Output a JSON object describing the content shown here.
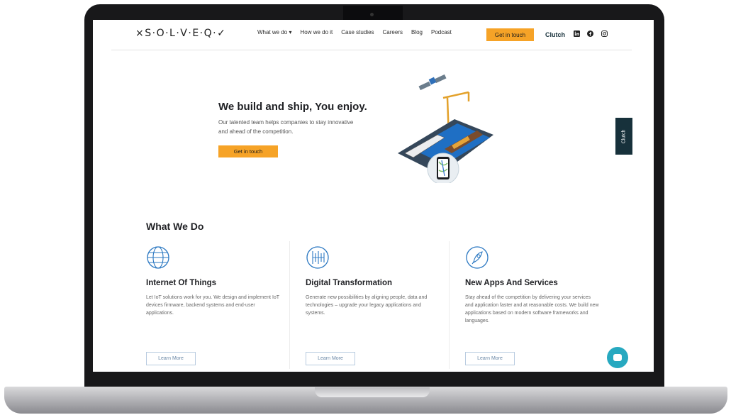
{
  "header": {
    "logo": "×S·O·L·V·E·Q·✓",
    "nav": [
      "What we do ▾",
      "How we do it",
      "Case studies",
      "Careers",
      "Blog",
      "Podcast"
    ],
    "cta": "Get in touch",
    "clutch": "Clutch",
    "social_icons": [
      "linkedin-icon",
      "facebook-icon",
      "instagram-icon"
    ]
  },
  "hero": {
    "title": "We build and ship, You enjoy.",
    "subtitle": "Our talented team helps companies to stay innovative and ahead of the competition.",
    "button": "Get in touch"
  },
  "side_tab": "Clutch",
  "what_we_do": {
    "title": "What We Do",
    "columns": [
      {
        "icon": "globe-icon",
        "title": "Internet Of Things",
        "desc": "Let IoT solutions work for you. We design and implement IoT devices firmware, backend systems and end-user applications.",
        "button": "Learn More"
      },
      {
        "icon": "circuit-icon",
        "title": "Digital Transformation",
        "desc": "Generate new possibilities by aligning people, data and technologies – upgrade your legacy applications and systems.",
        "button": "Learn More"
      },
      {
        "icon": "rocket-icon",
        "title": "New Apps And Services",
        "desc": "Stay ahead of the competition by delivering your services and application faster and at reasonable costs. We build new applications based on modern software frameworks and languages.",
        "button": "Learn More"
      }
    ]
  },
  "colors": {
    "accent": "#f6a327",
    "dark": "#17313b",
    "chat": "#27a9c0"
  }
}
